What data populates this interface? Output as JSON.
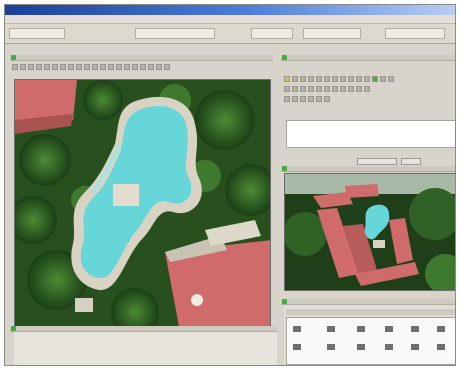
{
  "window": {
    "title": ""
  },
  "menu": {
    "items": [
      "",
      "",
      "",
      "",
      "",
      "",
      "",
      "",
      "",
      "",
      ""
    ]
  },
  "location_bar": {
    "fields": [
      "",
      "",
      "",
      "",
      ""
    ]
  },
  "main_map": {
    "title": ""
  },
  "side_tools": {
    "title": ""
  },
  "properties": {
    "rows": [
      "",
      "",
      "",
      "",
      ""
    ]
  },
  "property_buttons": {
    "labels": [
      "",
      ""
    ]
  },
  "thumbnail": {
    "title": ""
  },
  "log_panel": {
    "title": "",
    "lines": [
      "",
      "",
      "",
      ""
    ]
  },
  "right_bottom": {
    "title": "",
    "tab_label": ""
  },
  "colors": {
    "pool_water": "#67d6d8",
    "pool_deck": "#d9d3c3",
    "roof": "#cf6b6a",
    "tree_dark": "#1f4d19",
    "tree_mid": "#3d7a2e",
    "accent_title": "#2a52b6",
    "status_green": "#3fae3f"
  }
}
